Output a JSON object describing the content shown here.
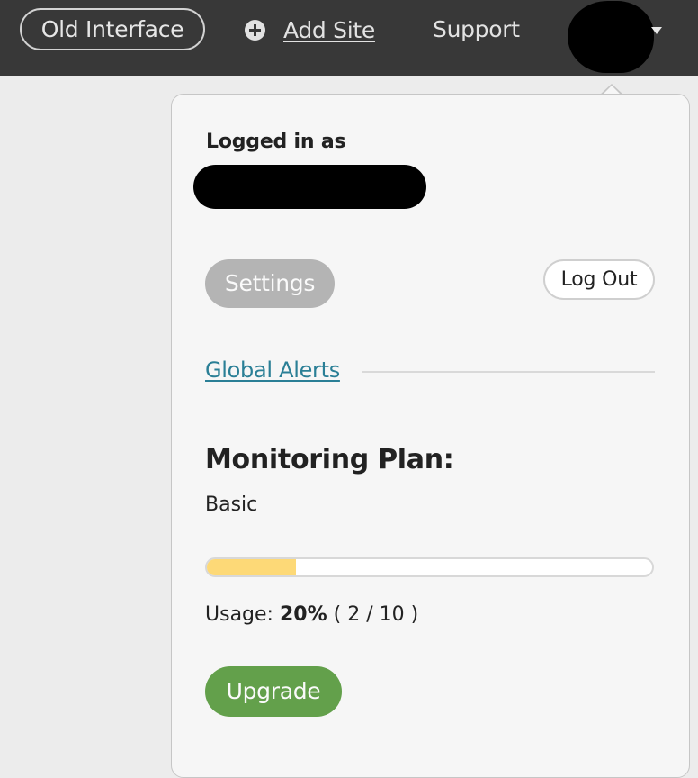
{
  "topbar": {
    "old_interface_label": "Old Interface",
    "add_site_label": "Add Site",
    "support_label": "Support"
  },
  "dropdown": {
    "logged_in_label": "Logged in as",
    "settings_label": "Settings",
    "logout_label": "Log Out",
    "global_alerts_label": "Global Alerts",
    "plan_heading": "Monitoring Plan:",
    "plan_name": "Basic",
    "usage": {
      "label": "Usage:",
      "percent_text": "20%",
      "count_text": "( 2 / 10 )",
      "used": 2,
      "total": 10,
      "fraction": 0.2
    },
    "upgrade_label": "Upgrade"
  },
  "colors": {
    "topbar_bg": "#383838",
    "link": "#2a7f96",
    "usage_fill": "#fdd977",
    "upgrade_bg": "#63a04b",
    "settings_bg": "#b4b4b4"
  },
  "icons": {
    "add_site": "plus-circle-icon",
    "user_menu": "caret-down-icon"
  }
}
